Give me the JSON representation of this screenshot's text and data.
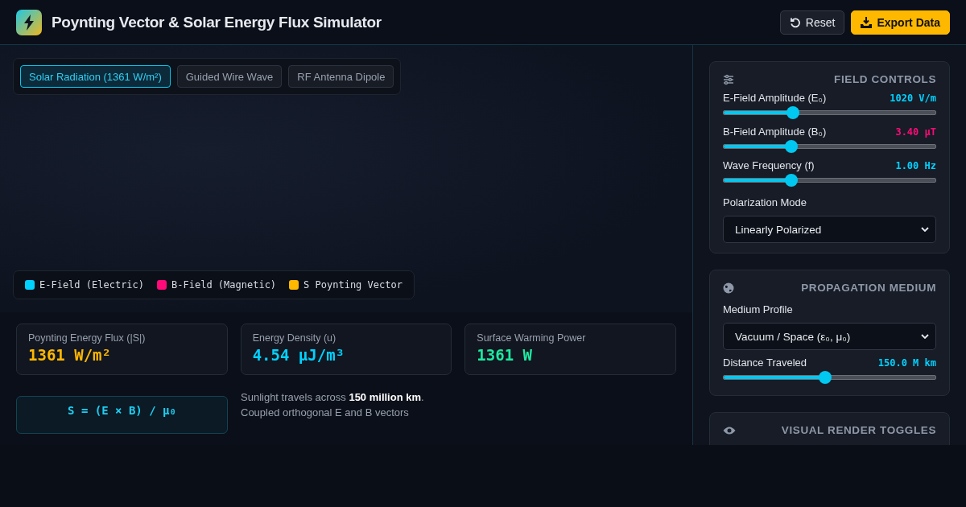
{
  "header": {
    "title": "Poynting Vector & Solar Energy Flux Simulator",
    "buttons": [
      {
        "label": "Reset",
        "kind": "secondary"
      },
      {
        "label": "Export Data",
        "kind": "primary"
      }
    ]
  },
  "tabs": [
    {
      "label": "Solar Radiation (1361 W/m²)",
      "selected": true
    },
    {
      "label": "Guided Wire Wave",
      "selected": false
    },
    {
      "label": "RF Antenna Dipole",
      "selected": false
    }
  ],
  "legend": [
    {
      "label": "E-Field (Electric)",
      "color": "#00d2ff"
    },
    {
      "label": "B-Field (Magnetic)",
      "color": "#ff0a78"
    },
    {
      "label": "S Poynting Vector",
      "color": "#ffb800"
    }
  ],
  "stats": [
    {
      "label": "Poynting Energy Flux (|S|)",
      "value": "1361 W/m²",
      "color": "#ffb800"
    },
    {
      "label": "Energy Density (u)",
      "value": "4.54 μJ/m³",
      "color": "#00d2ff"
    },
    {
      "label": "Surface Warming Power",
      "value": "1361 W",
      "color": "#1de9a0"
    }
  ],
  "formula": "S = (E × B) / μ₀",
  "description": "Sunlight travels across **150 million km**. Coupled orthogonal E and B vectors",
  "panels": [
    {
      "title": "FIELD CONTROLS",
      "controls": [
        {
          "kind": "slider",
          "label": "E-Field Amplitude (E₀)",
          "reading": "1020 V/m",
          "color": "#00d2ff",
          "level": 0.33
        },
        {
          "kind": "slider",
          "label": "B-Field Amplitude (B₀)",
          "reading": "3.40 μT",
          "color": "#ff0a78",
          "level": 0.32
        },
        {
          "kind": "slider",
          "label": "Wave Frequency (f)",
          "reading": "1.00 Hz",
          "color": "#00d2ff",
          "level": 0.32
        },
        {
          "kind": "select",
          "label": "Polarization Mode",
          "value": "Linearly Polarized"
        }
      ]
    },
    {
      "title": "PROPAGATION MEDIUM",
      "controls": [
        {
          "kind": "select",
          "label": "Medium Profile",
          "value": "Vacuum / Space (ε₀, μ₀)"
        },
        {
          "kind": "slider",
          "label": "Distance Traveled",
          "reading": "150.0 M km",
          "color": "#00d2ff",
          "level": 0.48
        }
      ]
    },
    {
      "title": "VISUAL RENDER TOGGLES"
    }
  ]
}
